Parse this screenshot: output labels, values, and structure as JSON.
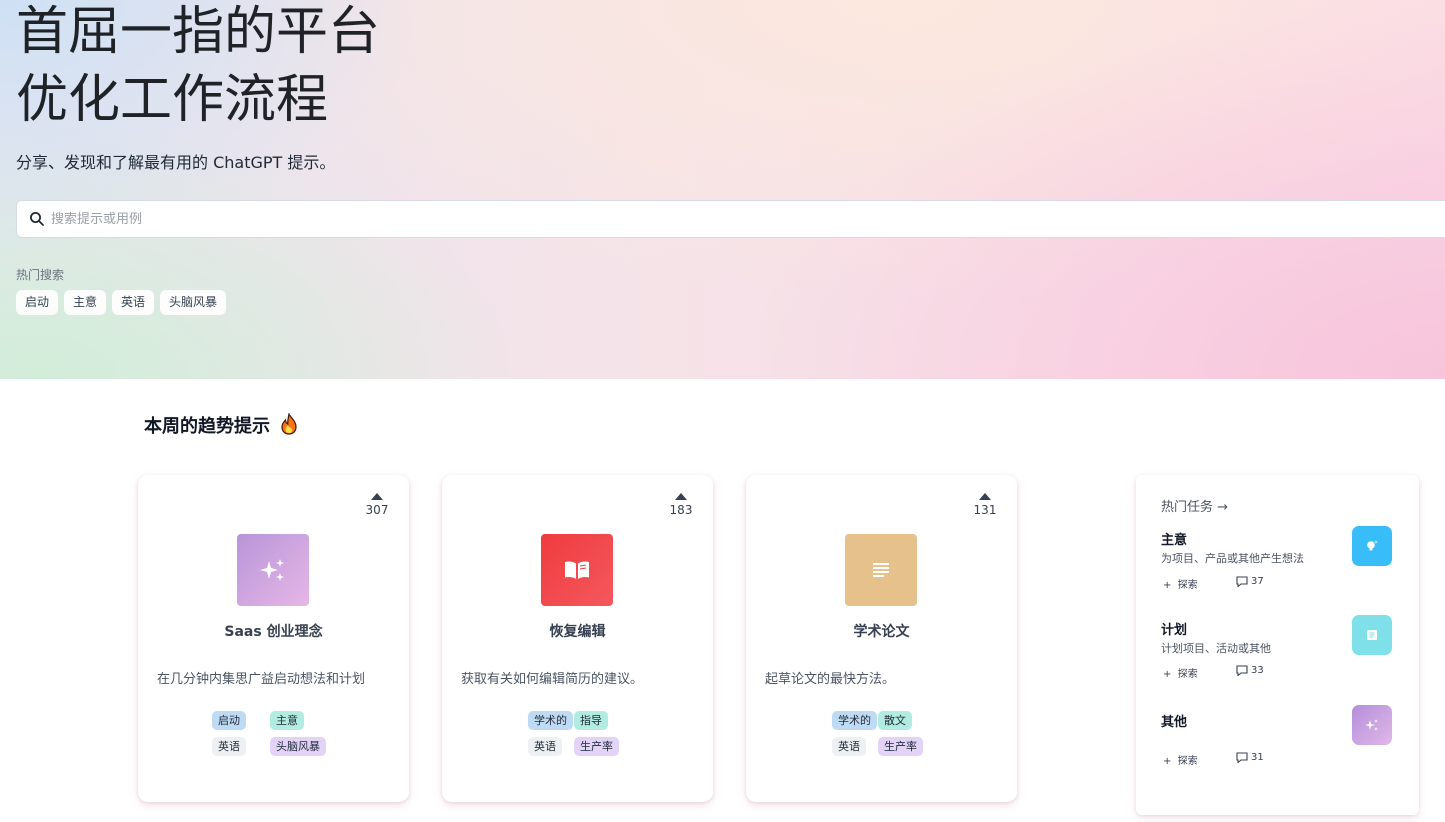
{
  "hero": {
    "title_line1": "首屈一指的平台",
    "title_line2": "优化工作流程",
    "subtitle": "分享、发现和了解最有用的 ChatGPT 提示。"
  },
  "search": {
    "placeholder": "搜索提示或用例",
    "value": ""
  },
  "popular_searches": {
    "label": "热门搜索",
    "tags": [
      "启动",
      "主意",
      "英语",
      "头脑风暴"
    ]
  },
  "trending": {
    "title": "本周的趋势提示",
    "cards": [
      {
        "votes": "307",
        "icon": "sparkles-icon",
        "title": "Saas 创业理念",
        "description": "在几分钟内集思广益启动想法和计划",
        "tags": [
          "启动",
          "主意",
          "英语",
          "头脑风暴"
        ]
      },
      {
        "votes": "183",
        "icon": "open-book-icon",
        "title": "恢复编辑",
        "description": "获取有关如何编辑简历的建议。",
        "tags": [
          "学术的",
          "指导",
          "英语",
          "生产率"
        ]
      },
      {
        "votes": "131",
        "icon": "document-lines-icon",
        "title": "学术论文",
        "description": "起草论文的最快方法。",
        "tags": [
          "学术的",
          "散文",
          "英语",
          "生产率"
        ]
      }
    ]
  },
  "hot_tasks": {
    "header": "热门任务 →",
    "items": [
      {
        "title": "主意",
        "description": "为项目、产品或其他产生想法",
        "explore_label": "探索",
        "comments": "37",
        "icon": "lightbulb-icon"
      },
      {
        "title": "计划",
        "description": "计划项目、活动或其他",
        "explore_label": "探索",
        "comments": "33",
        "icon": "clipboard-icon"
      },
      {
        "title": "其他",
        "description": "",
        "explore_label": "探索",
        "comments": "31",
        "icon": "sparkles-icon"
      }
    ]
  },
  "colors": {
    "card1_icon": "#c6a0de",
    "card2_icon": "#f04246",
    "card3_icon": "#e4c088",
    "task1_icon": "#38bdf8",
    "task2_icon": "#7fe0ea",
    "task3_icon": "#c196e0"
  }
}
